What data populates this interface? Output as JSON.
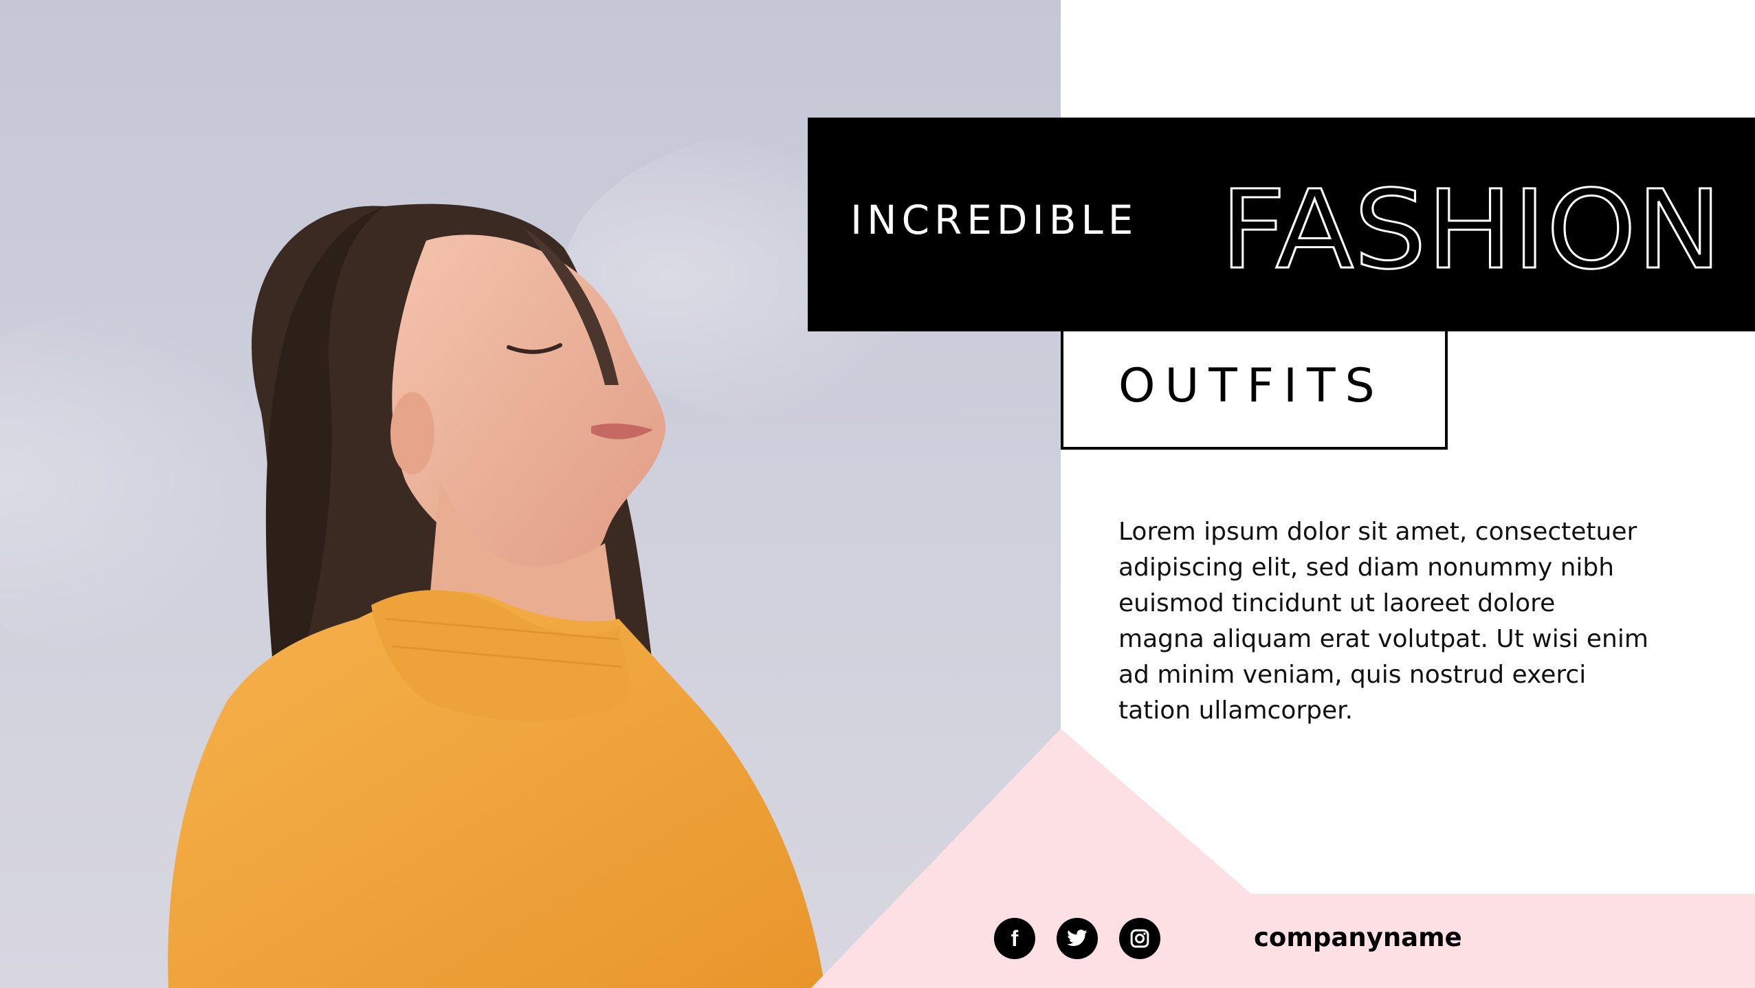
{
  "slide": {
    "banner": {
      "small_title": "INCREDIBLE",
      "big_title": "FASHION"
    },
    "subtitle": "OUTFITS",
    "body_lines": [
      "Lorem ipsum dolor sit amet, consectetuer",
      "adipiscing elit, sed diam nonummy nibh",
      "euismod tincidunt ut laoreet dolore",
      "magna aliquam erat volutpat. Ut wisi enim",
      "ad minim veniam, quis nostrud exerci",
      "tation ullamcorper."
    ],
    "footer": {
      "social_icons": [
        "facebook-icon",
        "twitter-icon",
        "instagram-icon"
      ],
      "company_name": "companyname"
    },
    "colors": {
      "pink": "#fce0e3",
      "black": "#000000",
      "white": "#ffffff",
      "sweater": "#f2a93f"
    }
  }
}
